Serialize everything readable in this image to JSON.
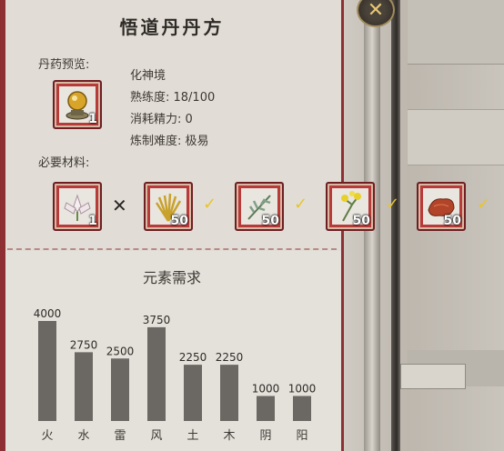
{
  "recipe": {
    "title": "悟道丹丹方",
    "preview_label": "丹药预览:",
    "materials_label": "必要材料:",
    "product": {
      "icon": "golden-pearl-icon",
      "count": "1"
    },
    "info": {
      "realm": "化神境",
      "proficiency": "熟练度: 18/100",
      "energy_cost": "消耗精力: 0",
      "difficulty": "炼制难度: 极易"
    },
    "materials": [
      {
        "icon": "white-lotus-icon",
        "count": "1",
        "status": "missing",
        "status_icon": "cross-icon"
      },
      {
        "icon": "golden-grass-icon",
        "count": "50",
        "status": "ok",
        "status_icon": "check-icon"
      },
      {
        "icon": "green-herb-icon",
        "count": "50",
        "status": "ok",
        "status_icon": "check-icon"
      },
      {
        "icon": "yellow-flower-icon",
        "count": "50",
        "status": "ok",
        "status_icon": "check-icon"
      },
      {
        "icon": "red-fungus-icon",
        "count": "50",
        "status": "ok",
        "status_icon": "check-icon"
      }
    ]
  },
  "close_icon": "close-icon",
  "colors": {
    "frame": "#8e2f34",
    "slot": "#b63b39",
    "check": "#e8c52a",
    "bar": "#6b6762"
  },
  "chart_data": {
    "type": "bar",
    "title": "元素需求",
    "categories": [
      "火",
      "水",
      "雷",
      "风",
      "土",
      "木",
      "阴",
      "阳"
    ],
    "values": [
      4000,
      2750,
      2500,
      3750,
      2250,
      2250,
      1000,
      1000
    ],
    "ylim": [
      0,
      4000
    ],
    "grid": false
  }
}
